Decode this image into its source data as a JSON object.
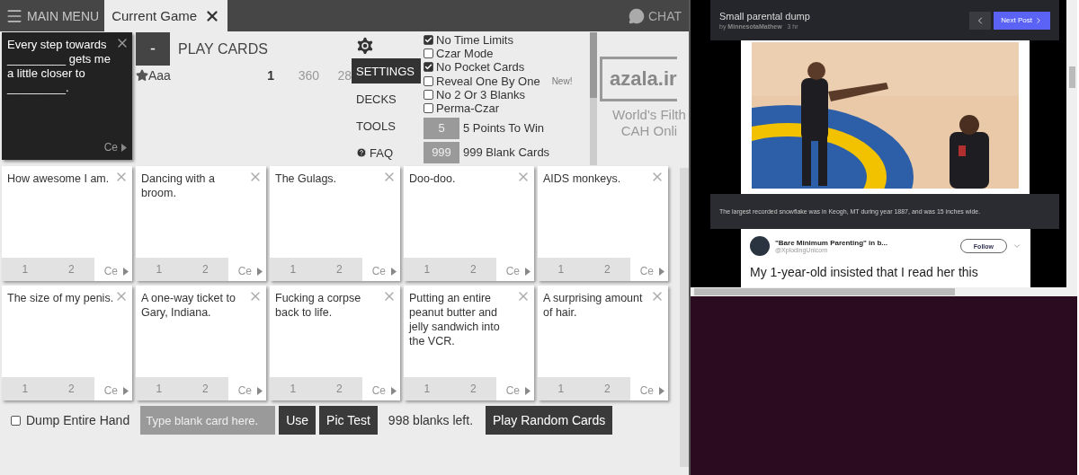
{
  "top_bar": {
    "menu_label": "MAIN MENU",
    "tab_label": "Current Game",
    "chat_label": "CHAT"
  },
  "black_card": {
    "text": "Every step towards _________ gets me a little closer to _________.",
    "footer": "Ce"
  },
  "play": {
    "button": "-",
    "title": "PLAY CARDS"
  },
  "players": [
    {
      "name": "Aaa",
      "values": [
        "1",
        "360",
        "28"
      ]
    }
  ],
  "settings_menu": [
    {
      "label": "SETTINGS",
      "selected": true,
      "kind": "plain"
    },
    {
      "label": "DECKS",
      "selected": false,
      "kind": "plain"
    },
    {
      "label": "TOOLS",
      "selected": false,
      "kind": "plain"
    },
    {
      "label": "FAQ",
      "selected": false,
      "kind": "help"
    }
  ],
  "options": [
    {
      "kind": "check",
      "label": "No Time Limits",
      "checked": true
    },
    {
      "kind": "check",
      "label": "Czar Mode",
      "checked": false
    },
    {
      "kind": "check",
      "label": "No Pocket Cards",
      "checked": true
    },
    {
      "kind": "check",
      "label": "Reveal One By One",
      "checked": false,
      "badge": "New!"
    },
    {
      "kind": "check",
      "label": "No 2 Or 3 Blanks",
      "checked": false
    },
    {
      "kind": "check",
      "label": "Perma-Czar",
      "checked": false
    },
    {
      "kind": "number",
      "value": "5",
      "label": "5 Points To Win"
    },
    {
      "kind": "number",
      "value": "999",
      "label": "999 Blank Cards"
    }
  ],
  "ad": {
    "logo": "azala.ir",
    "tagline": [
      "World's Filth",
      "CAH Onli"
    ]
  },
  "hand": [
    {
      "text": "How awesome I am.",
      "votes": [
        "1",
        "2"
      ],
      "footer": "Ce"
    },
    {
      "text": "Dancing with a broom.",
      "votes": [
        "1",
        "2"
      ],
      "footer": "Ce"
    },
    {
      "text": "The Gulags.",
      "votes": [
        "1",
        "2"
      ],
      "footer": "Ce"
    },
    {
      "text": "Doo-doo.",
      "votes": [
        "1",
        "2"
      ],
      "footer": "Ce"
    },
    {
      "text": "AIDS monkeys.",
      "votes": [
        "1",
        "2"
      ],
      "footer": "Ce"
    },
    {
      "text": "The size of my penis.",
      "votes": [
        "1",
        "2"
      ],
      "footer": "Ce"
    },
    {
      "text": "A one-way ticket to Gary, Indiana.",
      "votes": [
        "1",
        "2"
      ],
      "footer": "Ce"
    },
    {
      "text": "Fucking a corpse back to life.",
      "votes": [
        "1",
        "2"
      ],
      "footer": "Ce"
    },
    {
      "text": "Putting an entire peanut butter and jelly sandwich into the VCR.",
      "votes": [
        "1",
        "2"
      ],
      "footer": "Ce"
    },
    {
      "text": "A surprising amount of hair.",
      "votes": [
        "1",
        "2"
      ],
      "footer": "Ce"
    }
  ],
  "footer_bar": {
    "dump": {
      "label": "Dump Entire Hand",
      "checked": false
    },
    "blank_input": {
      "placeholder": "Type blank card here."
    },
    "buttons": [
      "Use",
      "Pic Test"
    ],
    "blanks_left": "998 blanks left.",
    "random_button": "Play Random Cards"
  },
  "browser_panel": {
    "post_title": "Small parental dump",
    "by": "by",
    "author": "MinnesotaMathew",
    "age": "3 hr",
    "next": "Next Post",
    "caption": "The largest recorded snowflake was in Keogh, MT during year 1887, and was 15 inches wide.",
    "tweet": {
      "name": "\"Bare Minimum Parenting\" in b...",
      "handle": "@XplodingUnicorn",
      "follow": "Follow",
      "text": "My 1-year-old insisted that I read her this"
    }
  }
}
